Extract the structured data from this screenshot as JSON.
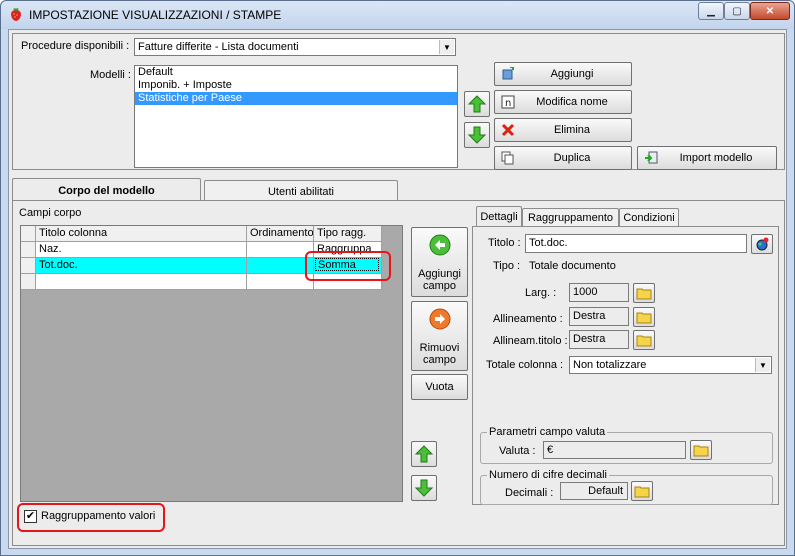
{
  "window": {
    "title": "IMPOSTAZIONE VISUALIZZAZIONI / STAMPE",
    "minimize": "▁",
    "maximize": "▢",
    "close": "✕"
  },
  "top": {
    "procedure_label": "Procedure disponibili :",
    "procedure_value": "Fatture differite - Lista documenti",
    "models_label": "Modelli :",
    "models": [
      {
        "label": "Default",
        "selected": false
      },
      {
        "label": "Imponib. + Imposte",
        "selected": false
      },
      {
        "label": "Statistiche per Paese",
        "selected": true
      }
    ],
    "buttons": {
      "add": "Aggiungi",
      "rename": "Modifica nome",
      "delete": "Elimina",
      "duplicate": "Duplica",
      "import": "Import modello"
    }
  },
  "tabs": {
    "body": "Corpo del modello",
    "users": "Utenti abilitati"
  },
  "body_fields": {
    "label": "Campi corpo",
    "columns": [
      "Titolo colonna",
      "Ordinamento",
      "Tipo ragg."
    ],
    "rows": [
      {
        "title": "Naz.",
        "order": "",
        "group": "Raggruppa"
      },
      {
        "title": "Tot.doc.",
        "order": "",
        "group": "Somma"
      },
      {
        "title": "",
        "order": "",
        "group": ""
      }
    ],
    "add_field": "Aggiungi campo",
    "remove_field": "Rimuovi campo",
    "empty": "Vuota",
    "grouping_checkbox": "Raggruppamento valori",
    "grouping_checked": true
  },
  "details": {
    "tabs": [
      "Dettagli",
      "Raggruppamento",
      "Condizioni"
    ],
    "title_label": "Titolo :",
    "title_value": "Tot.doc.",
    "type_label": "Tipo :",
    "type_value": "Totale documento",
    "width_label": "Larg. :",
    "width_value": "1000",
    "align_label": "Allineamento :",
    "align_value": "Destra",
    "title_align_label": "Allineam.titolo :",
    "title_align_value": "Destra",
    "total_label": "Totale colonna :",
    "total_value": "Non totalizzare",
    "currency_group": "Parametri campo valuta",
    "currency_label": "Valuta :",
    "currency_value": "€",
    "decimals_group": "Numero di cifre decimali",
    "decimals_label": "Decimali :",
    "decimals_value": "Default"
  },
  "colors": {
    "selection": "#3399ff",
    "row_highlight": "#00ffff",
    "annotation": "#e8141c",
    "arrow_green": "#2e9e22"
  }
}
